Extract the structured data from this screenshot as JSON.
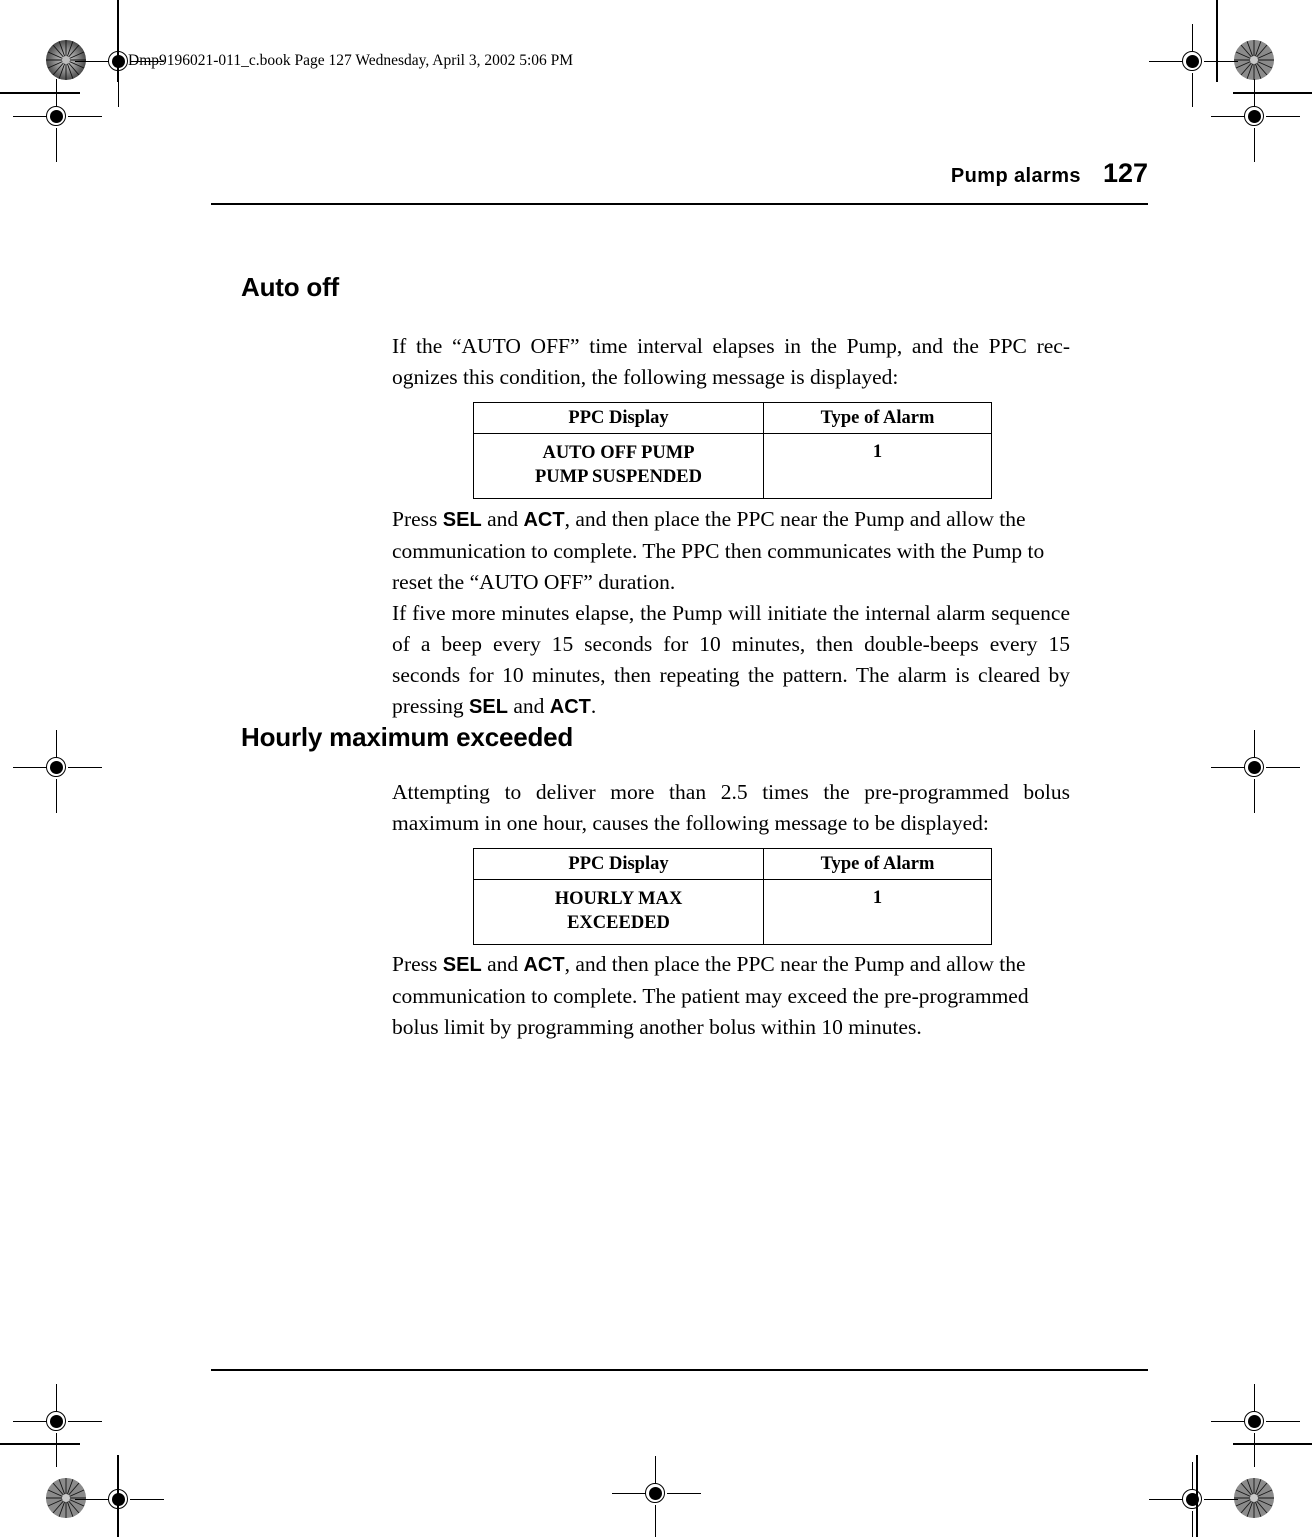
{
  "page": {
    "file_stamp": "Dmp9196021-011_c.book  Page 127  Wednesday, April 3, 2002  5:06 PM",
    "running_head": "Pump alarms",
    "folio": "127"
  },
  "sections": [
    {
      "heading": "Auto off",
      "intro": "If the “AUTO OFF” time interval elapses in the Pump, and the PPC rec-ognizes this condition, the following message is displayed:",
      "table": {
        "headers": [
          "PPC Display",
          "Type of Alarm"
        ],
        "rows": [
          {
            "display_line_1": "AUTO OFF PUMP",
            "display_line_2": "PUMP SUSPENDED",
            "alarm_type": "1"
          }
        ]
      },
      "paragraphs": [
        {
          "prefix": "Press ",
          "key_1": "SEL",
          "mid": " and ",
          "key_2": "ACT",
          "suffix": ", and then place the PPC near the Pump and allow the communication to complete. The PPC then communicates with the Pump to reset the “AUTO OFF” duration."
        },
        {
          "prefix": "If five more minutes elapse, the Pump will initiate the internal alarm sequence of a beep every 15 seconds for 10 minutes, then double-beeps every 15 seconds for 10 minutes, then repeating the pattern. The alarm is cleared by pressing ",
          "key_1": "SEL",
          "mid": " and ",
          "key_2": "ACT",
          "suffix": "."
        }
      ]
    },
    {
      "heading": "Hourly maximum exceeded",
      "intro": "Attempting to deliver more than 2.5 times the pre-programmed bolus maximum in one hour, causes the following message to be displayed:",
      "table": {
        "headers": [
          "PPC Display",
          "Type of Alarm"
        ],
        "rows": [
          {
            "display_line_1": "HOURLY MAX",
            "display_line_2": "EXCEEDED",
            "alarm_type": "1"
          }
        ]
      },
      "paragraphs": [
        {
          "prefix": "Press ",
          "key_1": "SEL",
          "mid": " and ",
          "key_2": "ACT",
          "suffix": ", and then place the PPC near the Pump and allow the communication to complete. The patient may exceed the pre-programmed bolus limit by programming another bolus within 10 minutes."
        }
      ]
    }
  ],
  "printer_marks": {
    "registration_icon": "registration-target-icon",
    "rosette_icon": "color-rosette-icon",
    "crop_icon": "crop-mark-icon"
  }
}
